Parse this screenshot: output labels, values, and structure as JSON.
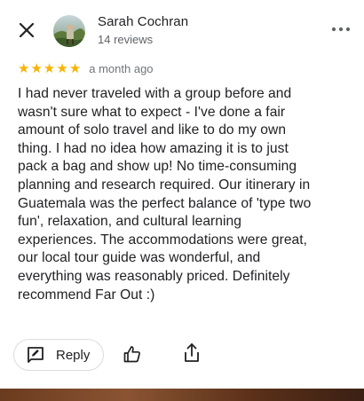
{
  "reviewer": {
    "name": "Sarah Cochran",
    "reviews_count": "14 reviews"
  },
  "review": {
    "rating": 5,
    "stars": [
      "★",
      "★",
      "★",
      "★",
      "★"
    ],
    "date": "a month ago",
    "lines": [
      "I had never traveled with a group before and",
      "wasn't sure what to expect - I've done a fair",
      "amount of solo travel and like to do my own",
      "thing. I had no idea how amazing it is to just",
      "pack a bag and show up! No time-consuming",
      "planning and research required. Our itinerary in",
      "Guatemala was the perfect balance of 'type two",
      "fun', relaxation, and cultural learning",
      "experiences. The accommodations were great,",
      "our local tour guide was wonderful, and",
      "everything was reasonably priced. Definitely",
      "recommend Far Out :)"
    ]
  },
  "actions": {
    "reply_label": "Reply"
  },
  "icons": {
    "close": "close-icon",
    "more": "more-vert-icon",
    "reply": "reply-edit-icon",
    "like": "thumb-up-icon",
    "share": "share-icon"
  },
  "colors": {
    "star": "#f6b400",
    "text_primary": "#202124",
    "text_secondary": "#5f6368",
    "border": "#dadce0"
  }
}
